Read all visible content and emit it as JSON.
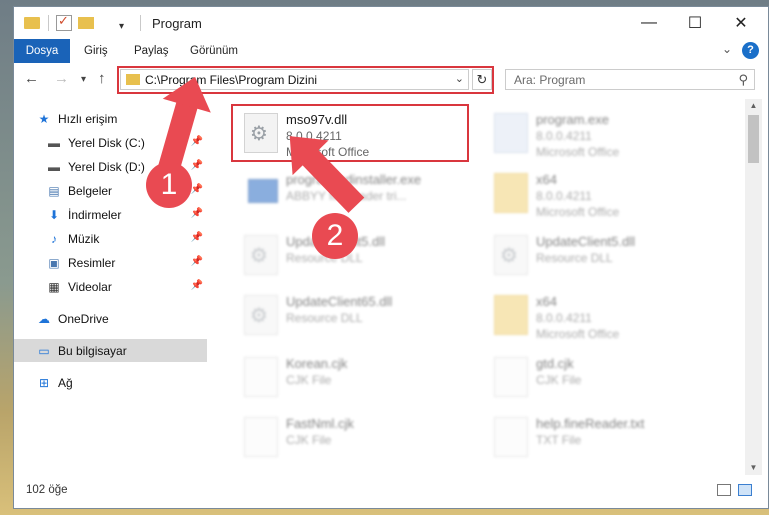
{
  "window": {
    "title": "Program"
  },
  "ribbon": {
    "tabs": [
      "Dosya",
      "Giriş",
      "Paylaş",
      "Görünüm"
    ]
  },
  "address": {
    "path": "C:\\Program Files\\Program Dizini"
  },
  "search": {
    "placeholder": "Ara: Program"
  },
  "sidebar": {
    "items": [
      {
        "label": "Hızlı erişim",
        "icon": "star-icon"
      },
      {
        "label": "Yerel Disk (C:)",
        "icon": "drive-icon"
      },
      {
        "label": "Yerel Disk (D:)",
        "icon": "drive-icon"
      },
      {
        "label": "Belgeler",
        "icon": "documents-icon"
      },
      {
        "label": "İndirmeler",
        "icon": "download-icon"
      },
      {
        "label": "Müzik",
        "icon": "music-icon"
      },
      {
        "label": "Resimler",
        "icon": "pictures-icon"
      },
      {
        "label": "Videolar",
        "icon": "video-icon"
      },
      {
        "label": "OneDrive",
        "icon": "cloud-icon"
      },
      {
        "label": "Bu bilgisayar",
        "icon": "computer-icon"
      },
      {
        "label": "Ağ",
        "icon": "network-icon"
      }
    ]
  },
  "files": [
    {
      "name": "mso97v.dll",
      "line1": "8.0.0.4211",
      "line2": "Microsoft Office",
      "icon": "dll-icon"
    },
    {
      "name": "program.exe",
      "line1": "8.0.0.4211",
      "line2": "Microsoft Office",
      "icon": "exe-icon"
    },
    {
      "name": "programmdinstaller.exe",
      "line1": "ABBYY finereader tri...",
      "line2": "",
      "icon": "installer-icon"
    },
    {
      "name": "x64",
      "line1": "8.0.0.4211",
      "line2": "Microsoft Office",
      "icon": "folder-icon"
    },
    {
      "name": "UpdateClient5.dll",
      "line1": "Resource DLL",
      "line2": "",
      "icon": "dll-icon"
    },
    {
      "name": "UpdateClient5.dll",
      "line1": "Resource DLL",
      "line2": "",
      "icon": "dll-icon"
    },
    {
      "name": "UpdateClient65.dll",
      "line1": "Resource DLL",
      "line2": "",
      "icon": "dll-icon"
    },
    {
      "name": "x64",
      "line1": "8.0.0.4211",
      "line2": "Microsoft Office",
      "icon": "folder-icon"
    },
    {
      "name": "Korean.cjk",
      "line1": "CJK File",
      "line2": "",
      "icon": "file-icon"
    },
    {
      "name": "gtd.cjk",
      "line1": "CJK File",
      "line2": "",
      "icon": "file-icon"
    },
    {
      "name": "FastNml.cjk",
      "line1": "CJK File",
      "line2": "",
      "icon": "file-icon"
    },
    {
      "name": "help.fineReader.txt",
      "line1": "TXT File",
      "line2": "",
      "icon": "text-file-icon"
    }
  ],
  "callouts": [
    "1",
    "2"
  ],
  "status": {
    "count": "102 öğe"
  },
  "colors": {
    "accent": "#1a63b8",
    "highlight": "#d9363e",
    "callout": "#e94a52"
  }
}
